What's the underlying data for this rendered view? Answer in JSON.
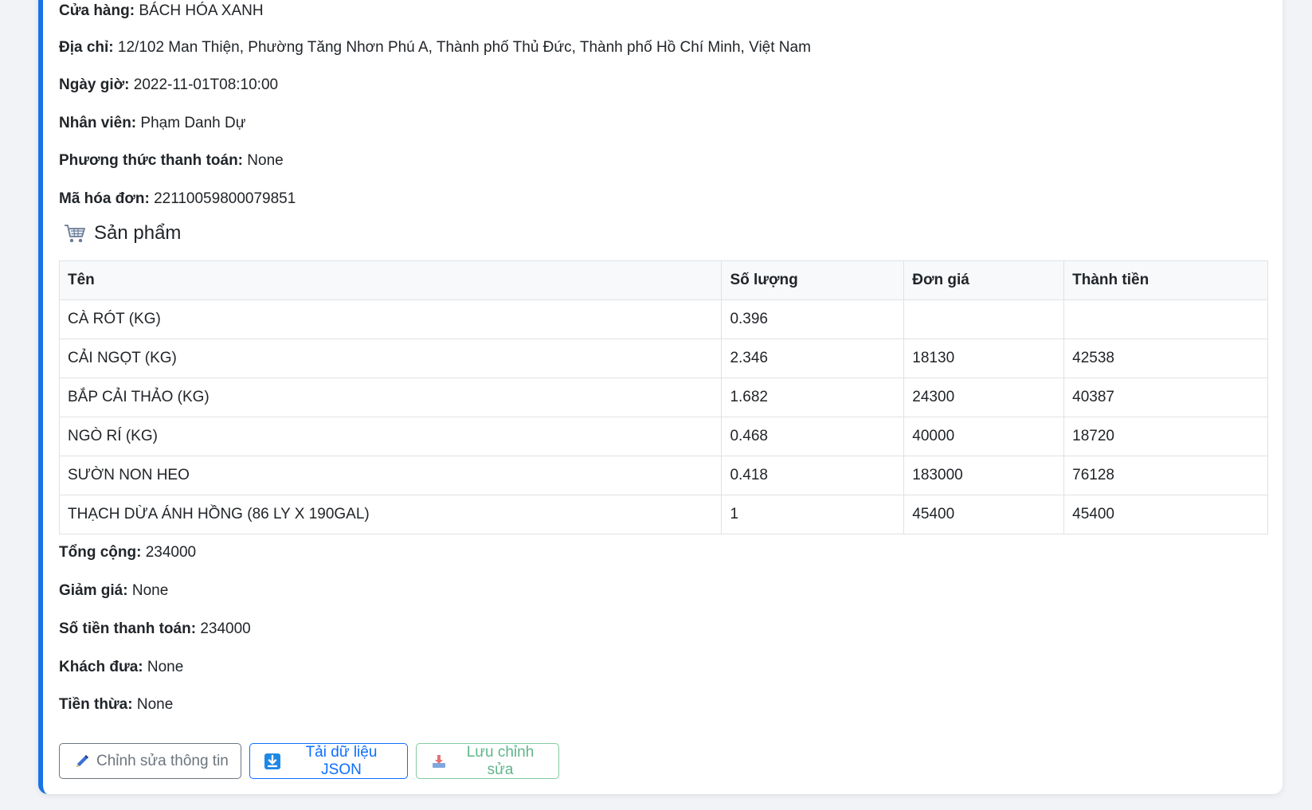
{
  "info": {
    "store": {
      "label": "Cửa hàng:",
      "value": "BÁCH HÓA XANH"
    },
    "address": {
      "label": "Địa chỉ:",
      "value": "12/102 Man Thiện, Phường Tăng Nhơn Phú A, Thành phố Thủ Đức, Thành phố Hồ Chí Minh, Việt Nam"
    },
    "datetime": {
      "label": "Ngày giờ:",
      "value": "2022-11-01T08:10:00"
    },
    "staff": {
      "label": "Nhân viên:",
      "value": "Phạm Danh Dự"
    },
    "payment_method": {
      "label": "Phương thức thanh toán:",
      "value": "None"
    },
    "invoice_id": {
      "label": "Mã hóa đơn:",
      "value": "22110059800079851"
    }
  },
  "products": {
    "title": "Sản phẩm",
    "icon": "shopping-cart-icon",
    "headers": [
      "Tên",
      "Số lượng",
      "Đơn giá",
      "Thành tiền"
    ],
    "rows": [
      [
        "CÀ RÓT (KG)",
        "0.396",
        "",
        ""
      ],
      [
        "CẢI NGỌT (KG)",
        "2.346",
        "18130",
        "42538"
      ],
      [
        "BẮP CẢI THẢO (KG)",
        "1.682",
        "24300",
        "40387"
      ],
      [
        "NGÒ RÍ (KG)",
        "0.468",
        "40000",
        "18720"
      ],
      [
        "SƯỜN NON HEO",
        "0.418",
        "183000",
        "76128"
      ],
      [
        "THẠCH DỪA ÁNH HỒNG (86 LY X 190GAL)",
        "1",
        "45400",
        "45400"
      ]
    ]
  },
  "summary": {
    "total": {
      "label": "Tổng cộng:",
      "value": "234000"
    },
    "discount": {
      "label": "Giảm giá:",
      "value": "None"
    },
    "paid": {
      "label": "Số tiền thanh toán:",
      "value": "234000"
    },
    "given": {
      "label": "Khách đưa:",
      "value": "None"
    },
    "change": {
      "label": "Tiền thừa:",
      "value": "None"
    }
  },
  "buttons": {
    "edit": {
      "label": "Chỉnh sửa thông tin",
      "icon": "pen-icon"
    },
    "download": {
      "label": "Tải dữ liệu JSON",
      "icon": "download-arrow-icon"
    },
    "save": {
      "label": "Lưu chỉnh sửa",
      "icon": "save-icon"
    }
  },
  "colors": {
    "accent": "#1a73e8",
    "edit": "#6c757d",
    "download": "#0d6efd",
    "save": "#5fb58a"
  }
}
